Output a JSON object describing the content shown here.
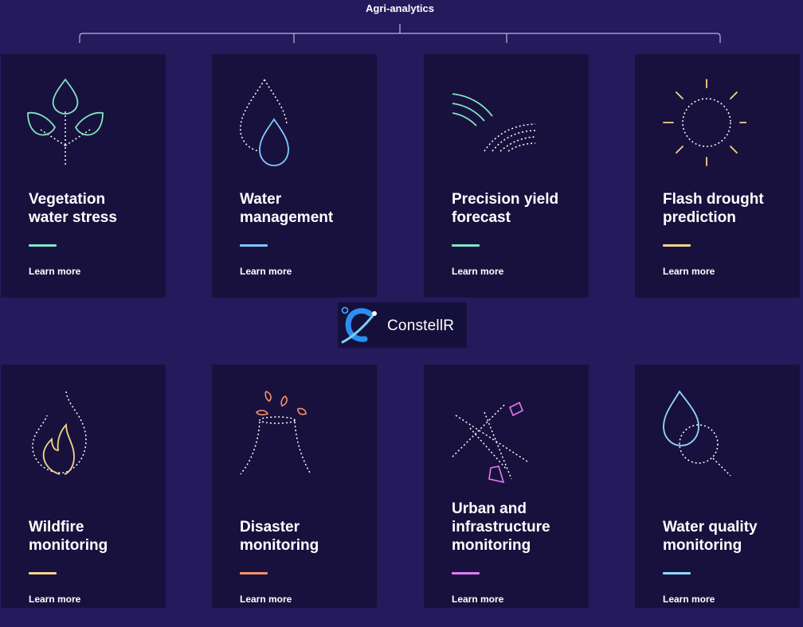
{
  "header": {
    "title": "Agri-analytics"
  },
  "logo": {
    "text": "ConstellR"
  },
  "colors": {
    "background": "#241a5c",
    "card": "#19113d",
    "green": "#7fe6c4",
    "blue": "#7fc8ff",
    "yellow": "#f4d58a",
    "orange": "#f3936b",
    "purple": "#e07cf3",
    "cyan": "#8fd9ff"
  },
  "cards": [
    {
      "title_line1": "Vegetation",
      "title_line2": "water stress",
      "link": "Learn more",
      "icon": "leaf-sprout-icon"
    },
    {
      "title_line1": "Water",
      "title_line2": "management",
      "link": "Learn more",
      "icon": "water-drop-icon"
    },
    {
      "title_line1": "Precision yield",
      "title_line2": "forecast",
      "link": "Learn more",
      "icon": "field-rows-icon"
    },
    {
      "title_line1": "Flash drought",
      "title_line2": "prediction",
      "link": "Learn more",
      "icon": "sun-icon"
    },
    {
      "title_line1": "Wildfire",
      "title_line2": "monitoring",
      "link": "Learn more",
      "icon": "flame-icon"
    },
    {
      "title_line1": "Disaster",
      "title_line2": "monitoring",
      "link": "Learn more",
      "icon": "volcano-icon"
    },
    {
      "title_line1": "Urban and",
      "title_line2": "infrastructure",
      "title_line3": "monitoring",
      "link": "Learn more",
      "icon": "city-map-icon"
    },
    {
      "title_line1": "Water quality",
      "title_line2": "monitoring",
      "link": "Learn more",
      "icon": "water-magnifier-icon"
    }
  ]
}
